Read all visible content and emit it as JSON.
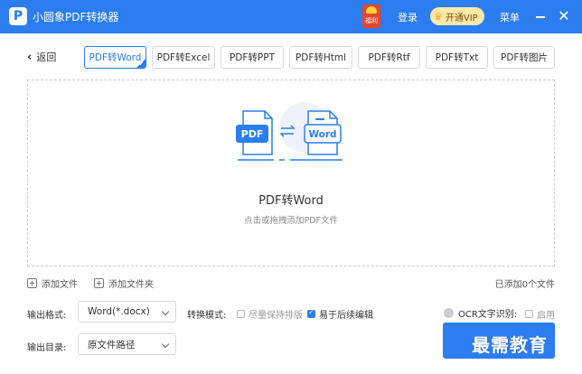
{
  "app": {
    "logo_letter": "P",
    "title": "小圆象PDF转换器"
  },
  "header": {
    "gift_label": "福利",
    "login_label": "登录",
    "vip_label": "开通VIP",
    "menu_label": "菜单",
    "minimize_icon": "minimize-icon",
    "close_icon": "close-icon",
    "close_glyph": "✕",
    "colors": {
      "bar": "#2b7df0",
      "vip_bg": "#fde9a8",
      "gift": "#e8452b"
    }
  },
  "toolbar": {
    "back_label": "返回",
    "tabs": [
      {
        "label": "PDF转Word",
        "active": true
      },
      {
        "label": "PDF转Excel",
        "active": false
      },
      {
        "label": "PDF转PPT",
        "active": false
      },
      {
        "label": "PDF转Html",
        "active": false
      },
      {
        "label": "PDF转Rtf",
        "active": false
      },
      {
        "label": "PDF转Txt",
        "active": false
      },
      {
        "label": "PDF转图片",
        "active": false
      }
    ]
  },
  "dropzone": {
    "icon_left_label": "PDF",
    "icon_right_label": "Word",
    "title": "PDF转Word",
    "hint": "点击或拖拽添加PDF文件"
  },
  "actions": {
    "add_file_label": "添加文件",
    "add_folder_label": "添加文件夹",
    "added_count_text": "已添加0个文件"
  },
  "options": {
    "output_format_label": "输出格式:",
    "output_format_value": "Word(*.docx)",
    "convert_mode_label": "转换模式:",
    "mode_options": [
      {
        "label": "尽量保持排版",
        "checked": false
      },
      {
        "label": "易于后续编辑",
        "checked": true
      }
    ],
    "ocr_label": "OCR文字识别:",
    "ocr_enable_label": "启用",
    "ocr_enabled": false,
    "output_dir_label": "输出目录:",
    "output_dir_value": "原文件路径"
  },
  "watermark_text": "最需教育"
}
